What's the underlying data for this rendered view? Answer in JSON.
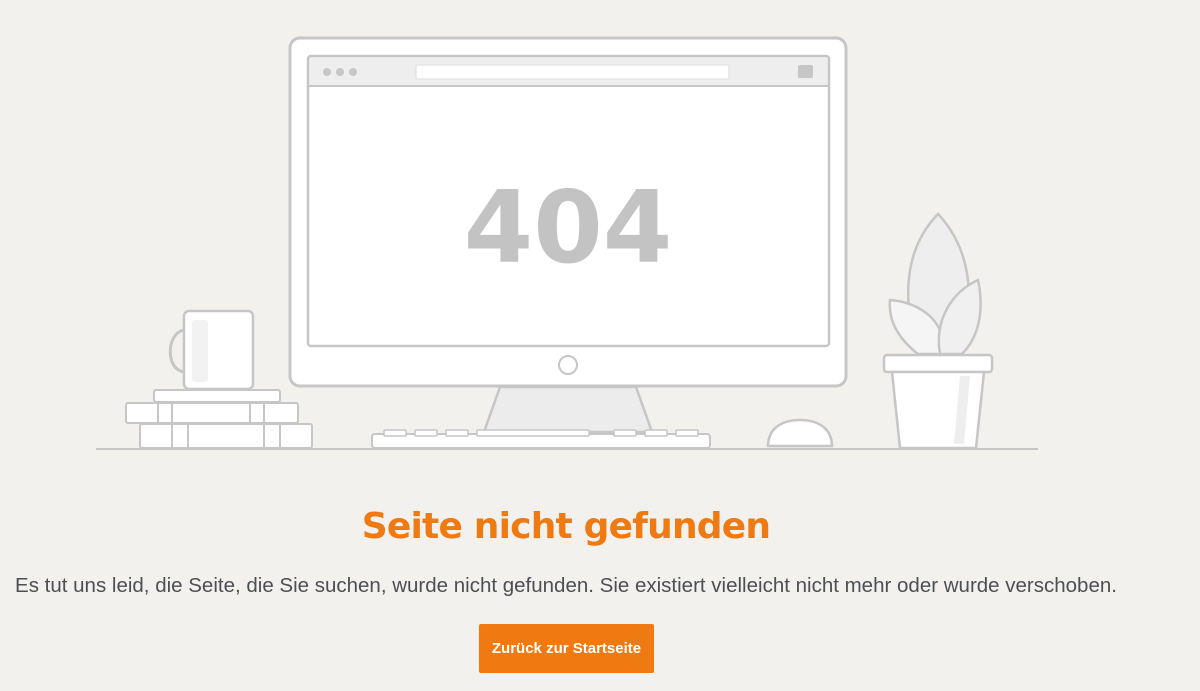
{
  "illustration": {
    "error_code": "404"
  },
  "content": {
    "title": "Seite nicht gefunden",
    "message": "Es tut uns leid, die Seite, die Sie suchen, wurde nicht gefunden. Sie existiert vielleicht nicht mehr oder wurde verschoben.",
    "home_button_label": "Zurück zur Startseite"
  },
  "colors": {
    "accent": "#ee7a11",
    "background": "#f3f1ee",
    "text": "#4c4f53",
    "illustration_stroke": "#c6c6c6",
    "illustration_fill": "#ffffff"
  },
  "icons": [
    "monitor-icon",
    "coffee-mug-icon",
    "book-stack-icon",
    "keyboard-icon",
    "mouse-icon",
    "plant-icon"
  ]
}
